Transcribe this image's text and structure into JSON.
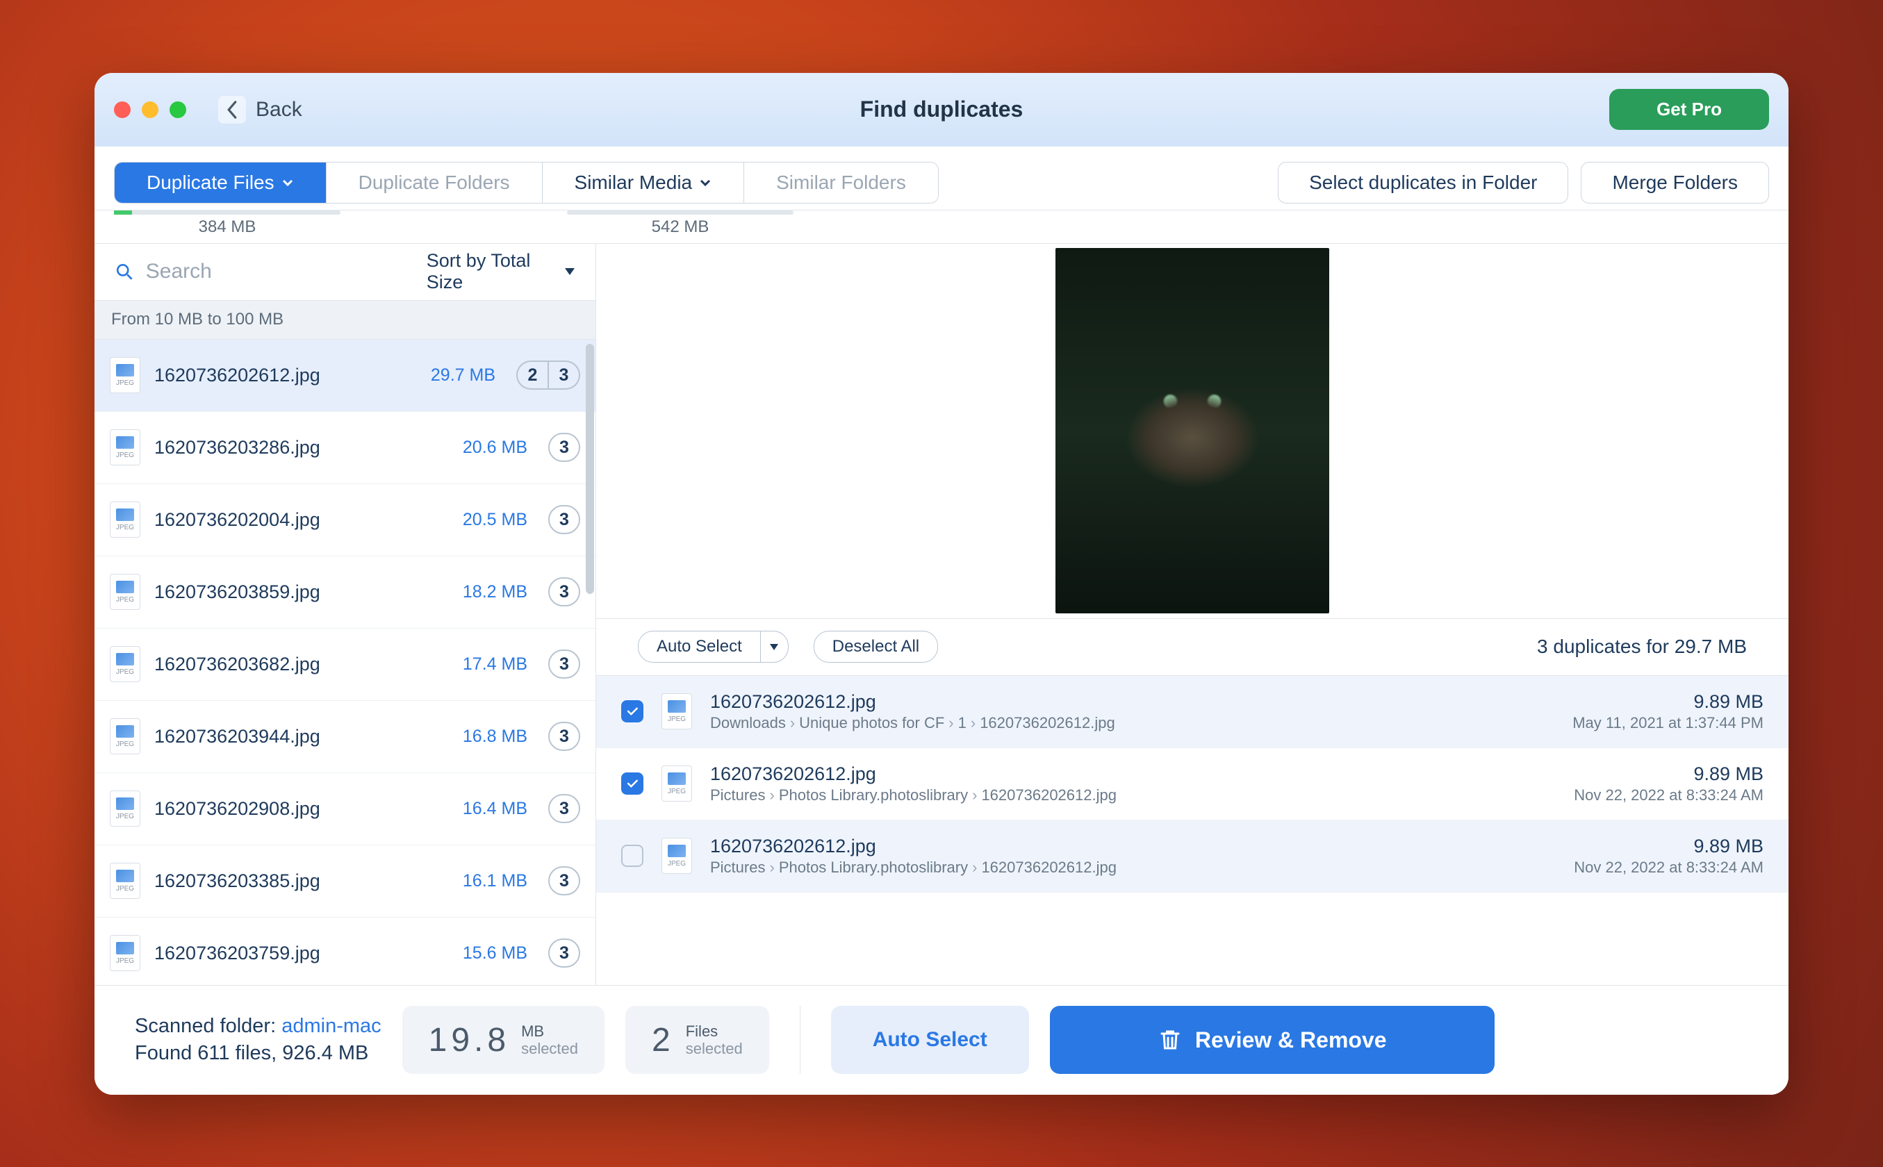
{
  "titlebar": {
    "back": "Back",
    "title": "Find duplicates",
    "getpro": "Get Pro"
  },
  "tabs": {
    "duplicate_files": "Duplicate Files",
    "duplicate_folders": "Duplicate Folders",
    "similar_media": "Similar Media",
    "similar_folders": "Similar Folders"
  },
  "sizes": {
    "dup_files": "384 MB",
    "sim_media": "542 MB"
  },
  "actions": {
    "select_in_folder": "Select duplicates in Folder",
    "merge_folders": "Merge Folders"
  },
  "search": {
    "placeholder": "Search",
    "sort_label": "Sort by Total Size"
  },
  "group_header": "From 10 MB to 100 MB",
  "files": [
    {
      "name": "1620736202612.jpg",
      "size": "29.7 MB",
      "badges": [
        "2",
        "3"
      ],
      "selected": true
    },
    {
      "name": "1620736203286.jpg",
      "size": "20.6 MB",
      "badges": [
        "3"
      ]
    },
    {
      "name": "1620736202004.jpg",
      "size": "20.5 MB",
      "badges": [
        "3"
      ]
    },
    {
      "name": "1620736203859.jpg",
      "size": "18.2 MB",
      "badges": [
        "3"
      ]
    },
    {
      "name": "1620736203682.jpg",
      "size": "17.4 MB",
      "badges": [
        "3"
      ]
    },
    {
      "name": "1620736203944.jpg",
      "size": "16.8 MB",
      "badges": [
        "3"
      ]
    },
    {
      "name": "1620736202908.jpg",
      "size": "16.4 MB",
      "badges": [
        "3"
      ]
    },
    {
      "name": "1620736203385.jpg",
      "size": "16.1 MB",
      "badges": [
        "3"
      ]
    },
    {
      "name": "1620736203759.jpg",
      "size": "15.6 MB",
      "badges": [
        "3"
      ]
    }
  ],
  "dup_toolbar": {
    "auto_select": "Auto Select",
    "deselect_all": "Deselect All",
    "summary": "3 duplicates for 29.7 MB"
  },
  "duplicates": [
    {
      "checked": true,
      "name": "1620736202612.jpg",
      "path": [
        "Downloads",
        "Unique photos for CF",
        "1",
        "1620736202612.jpg"
      ],
      "size": "9.89 MB",
      "date": "May 11, 2021 at 1:37:44 PM"
    },
    {
      "checked": true,
      "name": "1620736202612.jpg",
      "path": [
        "Pictures",
        "Photos Library.photoslibrary",
        "1620736202612.jpg"
      ],
      "size": "9.89 MB",
      "date": "Nov 22, 2022 at 8:33:24 AM"
    },
    {
      "checked": false,
      "name": "1620736202612.jpg",
      "path": [
        "Pictures",
        "Photos Library.photoslibrary",
        "1620736202612.jpg"
      ],
      "size": "9.89 MB",
      "date": "Nov 22, 2022 at 8:33:24 AM"
    }
  ],
  "footer": {
    "scanned_label": "Scanned folder:",
    "scanned_folder": "admin-mac",
    "found_line": "Found 611 files, 926.4 MB",
    "mb_selected_num": "19.8",
    "mb_selected_unit": "MB",
    "mb_selected_word": "selected",
    "files_selected_num": "2",
    "files_selected_unit": "Files",
    "files_selected_word": "selected",
    "auto_select": "Auto Select",
    "review_remove": "Review & Remove"
  }
}
